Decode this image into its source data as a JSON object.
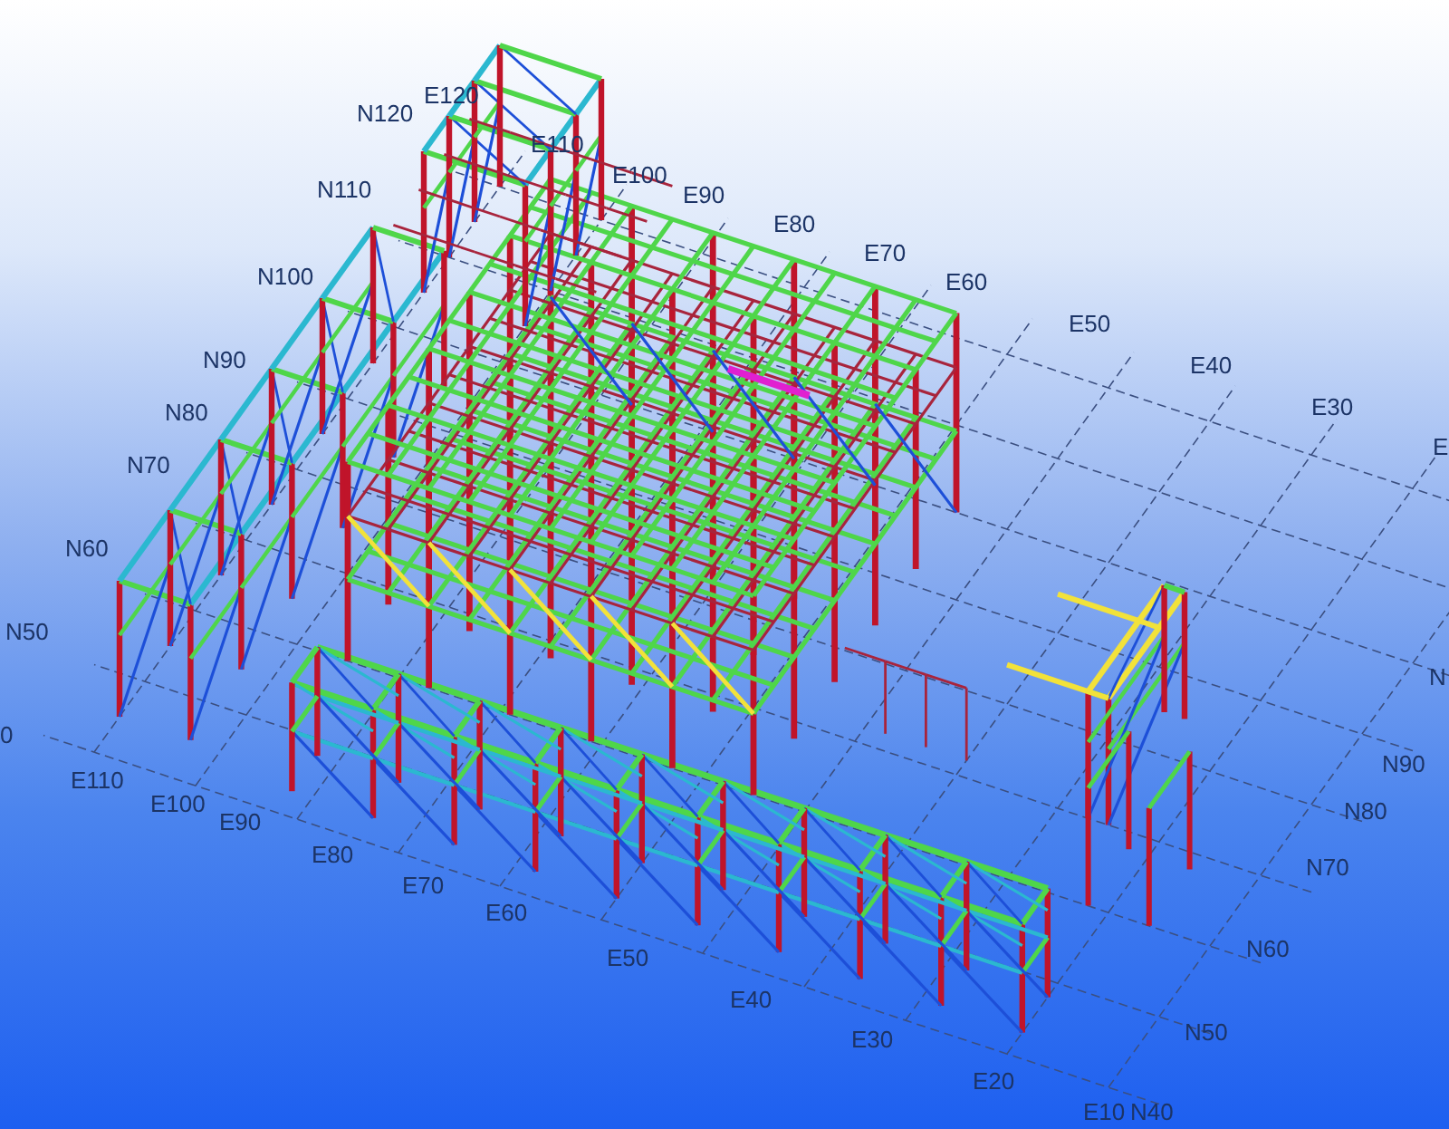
{
  "viewport": {
    "grid_labels": [
      "E120",
      "N120",
      "E110",
      "E100",
      "E90",
      "E80",
      "E70",
      "E60",
      "E50",
      "E40",
      "E30",
      "E",
      "N110",
      "N100",
      "N90",
      "N80",
      "N70",
      "N60",
      "N50",
      "0",
      "E110",
      "E100",
      "E90",
      "E80",
      "E70",
      "E60",
      "E50",
      "E40",
      "E30",
      "E20",
      "E10",
      "N40",
      "N90",
      "N80",
      "N70",
      "N60",
      "N50",
      "N"
    ]
  }
}
